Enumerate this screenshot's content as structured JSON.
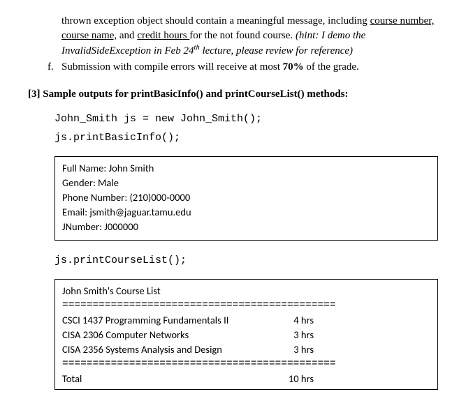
{
  "para1_part1": "thrown exception object should contain a meaningful message, including ",
  "para1_u1": "course number,",
  "para1_u2": "course name,",
  "para1_mid1": " and ",
  "para1_u3": "credit hours ",
  "para1_part2": "for the not found course. ",
  "para1_hint1": "(hint: I demo the InvalidSideException in Feb 24",
  "para1_hint_sup": "th",
  "para1_hint2": " lecture, please review for reference)",
  "item_f_marker": "f.",
  "item_f_text1": "Submission with compile errors will receive at most ",
  "item_f_bold": "70%",
  "item_f_text2": " of the grade.",
  "section3": "[3] Sample outputs for printBasicInfo() and printCourseList() methods:",
  "code1": "John_Smith js = new John_Smith();",
  "code2": "js.printBasicInfo();",
  "box1": {
    "l1": "Full Name: John Smith",
    "l2": "Gender: Male",
    "l3": "Phone Number: (210)000-0000",
    "l4": "Email: jsmith@jaguar.tamu.edu",
    "l5": "JNumber: J000000"
  },
  "code3": "js.printCourseList();",
  "box2": {
    "title": "John Smith's Course List",
    "div": "=============================================",
    "courses": [
      {
        "name": "CSCI 1437 Programming Fundamentals II",
        "hrs": "4 hrs"
      },
      {
        "name": "CISA 2306 Computer Networks",
        "hrs": "3 hrs"
      },
      {
        "name": "CISA 2356 Systems Analysis and Design",
        "hrs": "3 hrs"
      }
    ],
    "total_label": "Total",
    "total_hrs": "10 hrs"
  }
}
